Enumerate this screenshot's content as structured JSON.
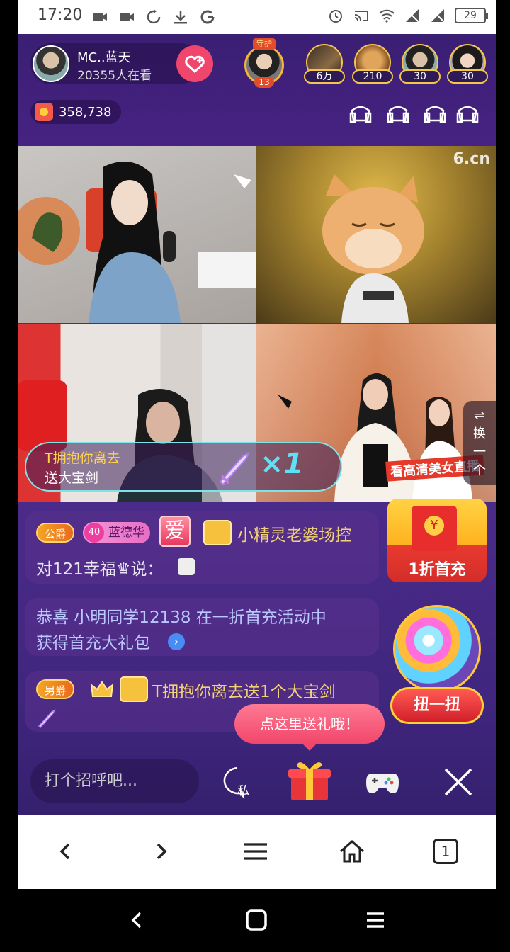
{
  "status_bar": {
    "time": "17:20",
    "battery": "29"
  },
  "header": {
    "host_name": "MC..蓝天",
    "viewers": "20355人在看",
    "guard_label": "守护",
    "guard_count": "13",
    "fans": [
      {
        "count": "6万"
      },
      {
        "count": "210"
      },
      {
        "count": "30"
      },
      {
        "count": "30"
      }
    ],
    "coins": "358,738"
  },
  "video": {
    "watermark": "6.cn",
    "gift_banner": {
      "line1": "T拥抱你离去",
      "line2": "送大宝剑",
      "multiplier": "×1"
    },
    "switch_label": "⇌ 换 一 个",
    "promo_text": "看高清美女直播"
  },
  "chat": [
    {
      "rank": "公爵",
      "level": "40",
      "name": "蓝德华",
      "love": "爱",
      "text": "小精灵老婆场控",
      "line2": "对121幸福♛说："
    },
    {
      "text": "恭喜 小明同学12138 在一折首充活动中",
      "line2": "获得首充大礼包"
    },
    {
      "rank": "男爵",
      "text": "T拥抱你离去送1个大宝剑"
    }
  ],
  "promo": {
    "first_charge": "1折首充",
    "gacha": "扭一扭",
    "tooltip": "点这里送礼哦！"
  },
  "bottom": {
    "input_placeholder": "打个招呼吧...",
    "private_label": "私"
  },
  "browser": {
    "tab_count": "1"
  }
}
